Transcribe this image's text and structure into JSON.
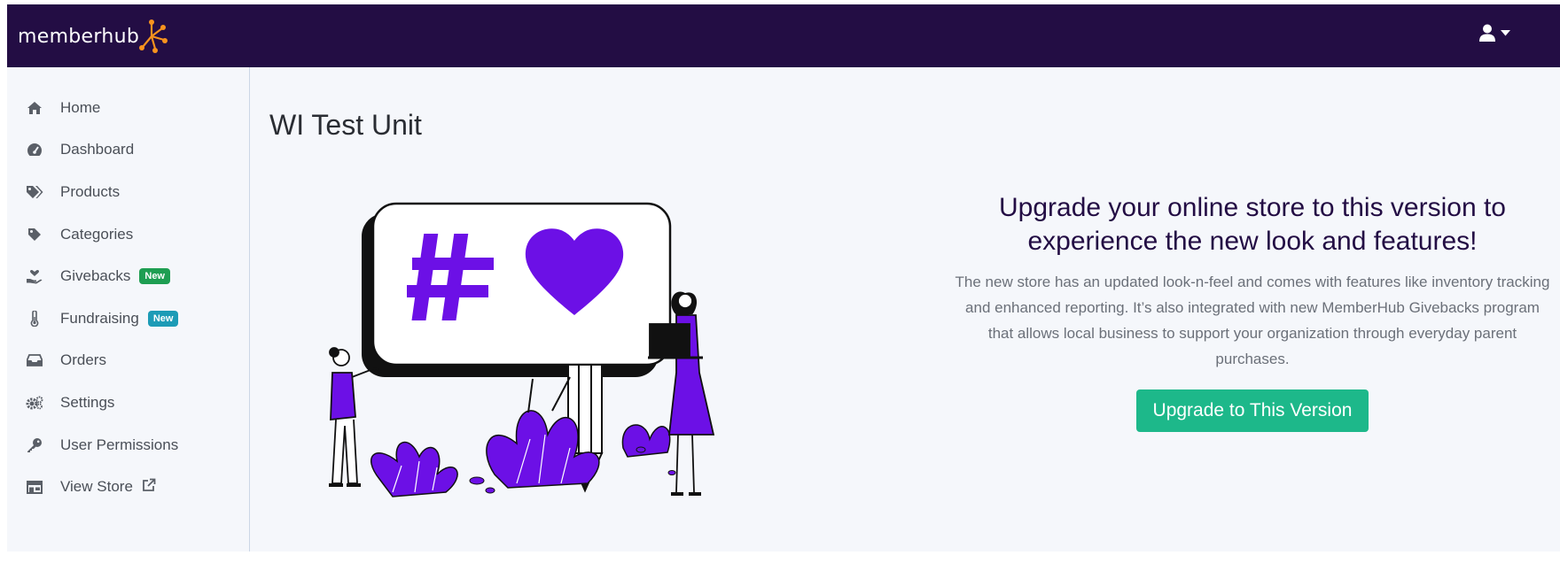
{
  "app": {
    "logo_text": "memberhub",
    "brand_color": "#230d44",
    "accent_color": "#f7931e"
  },
  "header": {
    "user_icon": "user-icon",
    "caret_icon": "caret-down-icon"
  },
  "sidebar": {
    "items": [
      {
        "label": "Home",
        "icon": "home-icon"
      },
      {
        "label": "Dashboard",
        "icon": "dashboard-gauge-icon"
      },
      {
        "label": "Products",
        "icon": "tags-icon"
      },
      {
        "label": "Categories",
        "icon": "tag-icon"
      },
      {
        "label": "Givebacks",
        "icon": "hand-holding-heart-icon",
        "badge": "New",
        "badge_color": "#1e9e52"
      },
      {
        "label": "Fundraising",
        "icon": "thermometer-icon",
        "badge": "New",
        "badge_color": "#1c9bb6"
      },
      {
        "label": "Orders",
        "icon": "inbox-tray-icon"
      },
      {
        "label": "Settings",
        "icon": "gears-icon"
      },
      {
        "label": "User Permissions",
        "icon": "key-icon"
      },
      {
        "label": "View Store",
        "icon": "storefront-icon",
        "trailing_icon": "external-link-icon"
      }
    ]
  },
  "main": {
    "title": "WI Test Unit",
    "promo": {
      "heading": "Upgrade your online store to this version to experience the new look and features!",
      "body": "The new store has an updated look-n-feel and comes with features like inventory tracking and enhanced reporting. It’s also integrated with new MemberHub Givebacks program that allows local business to support your organization through everyday parent purchases.",
      "button_label": "Upgrade to This Version",
      "button_color": "#1db88a"
    },
    "illustration": {
      "icon": "social-media-billboard-illustration",
      "symbols": [
        "#",
        "heart"
      ],
      "accent_color": "#6c10e6"
    }
  }
}
